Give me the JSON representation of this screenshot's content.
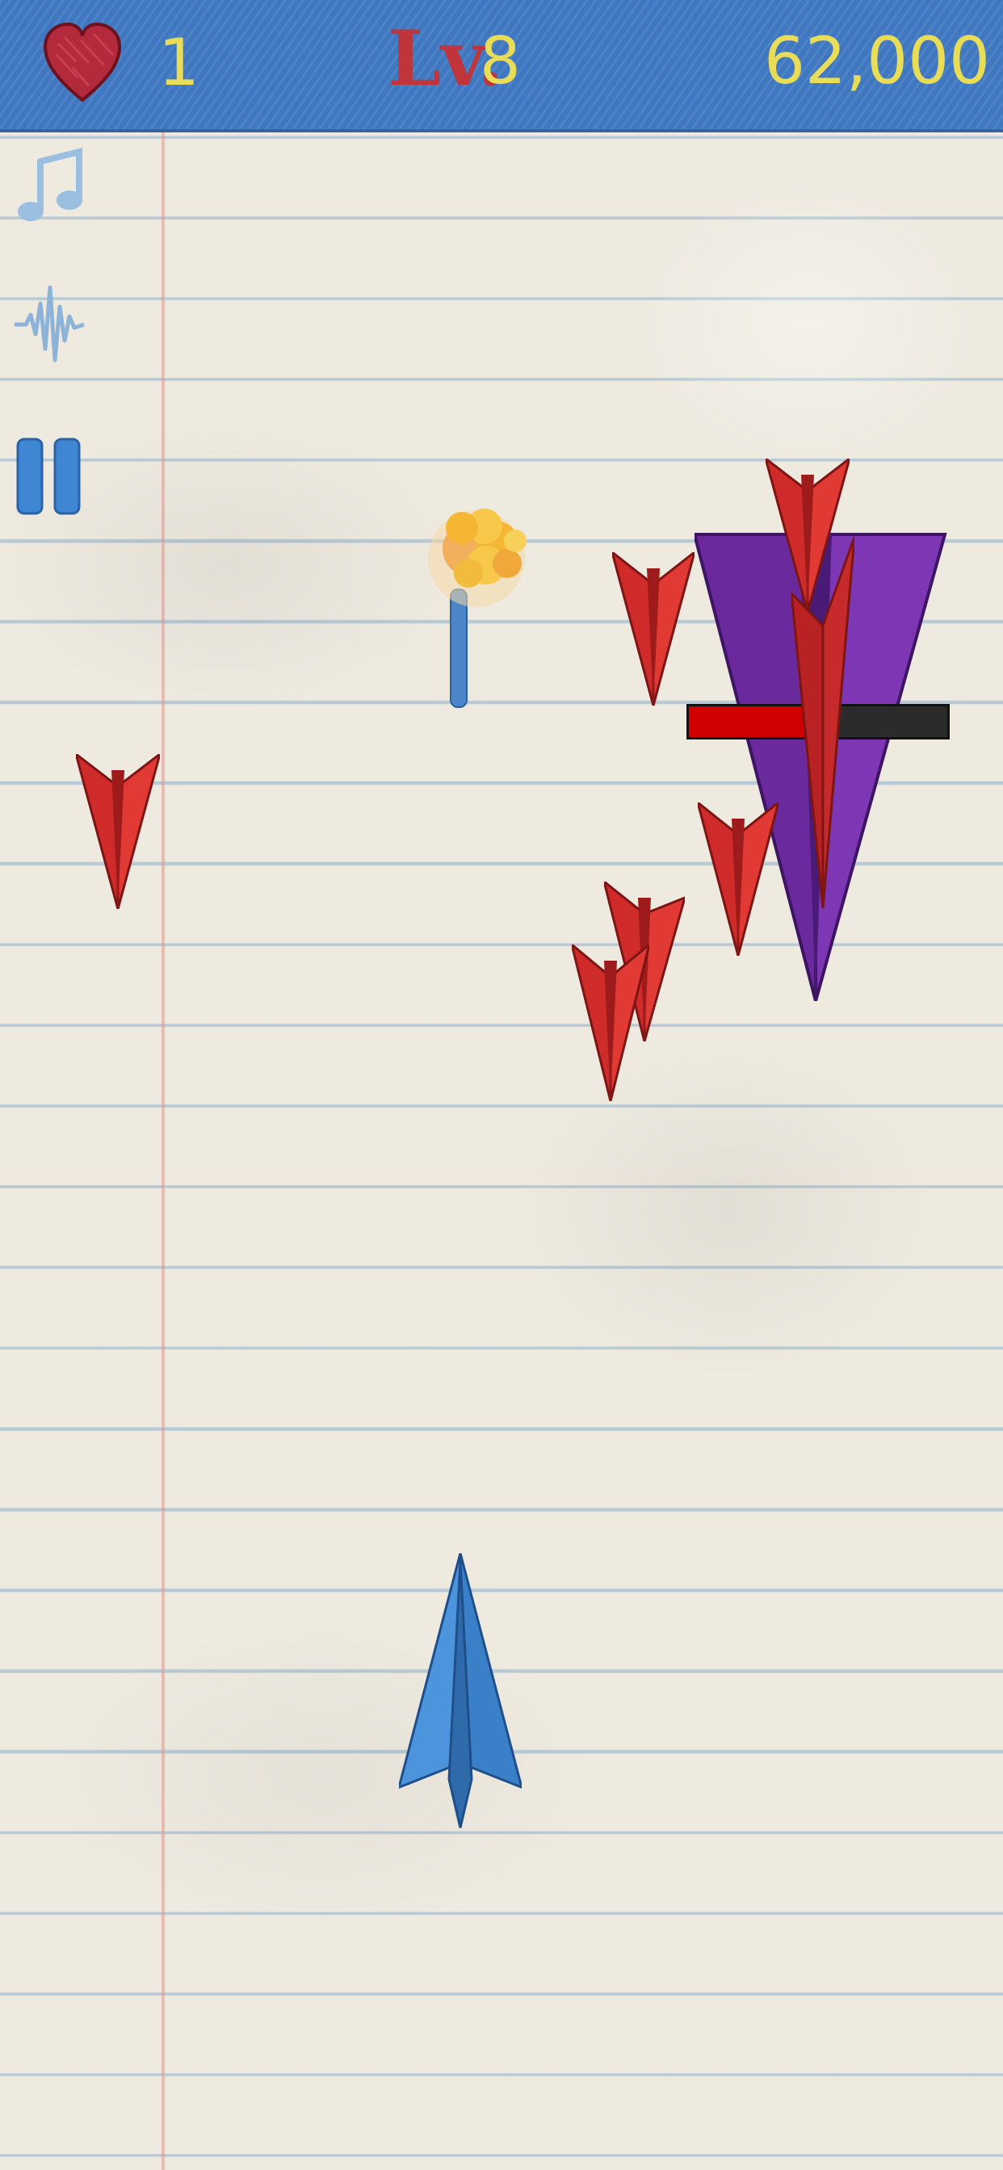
{
  "hud": {
    "lives": "1",
    "level_label": "Lv.",
    "level": "8",
    "score": "62,000",
    "bar_color": "#3f78c0",
    "text_color": "#e9dc56",
    "level_label_color": "#c0343b"
  },
  "controls": {
    "music_icon": "music-note-icon",
    "sound_icon": "sound-wave-icon",
    "pause_icon": "pause-icon"
  },
  "boss": {
    "color": "#6a2a9e",
    "health_fraction": 0.49
  },
  "enemy_color": "#cf2b2b",
  "player_color": "#3f86d3",
  "explosion_color": "#f5b634",
  "bullet_color": "#4a86c8"
}
